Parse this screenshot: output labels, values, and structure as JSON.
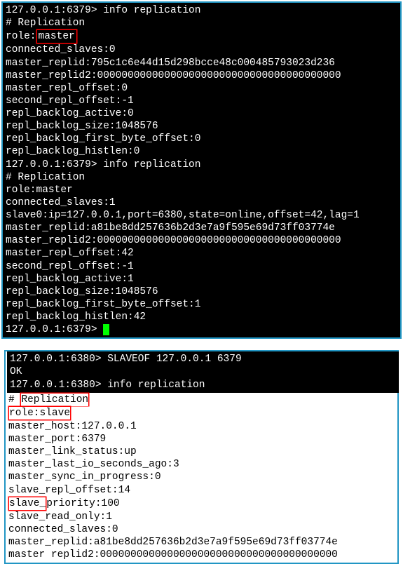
{
  "terminal1": {
    "prompt_a": "127.0.0.1:6379> ",
    "cmd_a": "info replication",
    "lines_a": [
      "# Replication",
      "role:",
      "connected_slaves:0",
      "master_replid:795c1c6e44d15d298bcce48c000485793023d236",
      "master_replid2:0000000000000000000000000000000000000000",
      "master_repl_offset:0",
      "second_repl_offset:-1",
      "repl_backlog_active:0",
      "repl_backlog_size:1048576",
      "repl_backlog_first_byte_offset:0",
      "repl_backlog_histlen:0"
    ],
    "role_hi_a": "master",
    "prompt_b": "127.0.0.1:6379> ",
    "cmd_b": "info replication",
    "lines_b": [
      "# Replication",
      "role:master",
      "connected_slaves:1",
      "slave0:ip=127.0.0.1,port=6380,state=online,offset=42,lag=1",
      "master_replid:a81be8dd257636b2d3e7a9f595e69d73ff03774e",
      "master_replid2:0000000000000000000000000000000000000000",
      "master_repl_offset:42",
      "second_repl_offset:-1",
      "repl_backlog_active:1",
      "repl_backlog_size:1048576",
      "repl_backlog_first_byte_offset:1",
      "repl_backlog_histlen:42"
    ],
    "prompt_c": "127.0.0.1:6379> "
  },
  "terminal2": {
    "header": {
      "prompt1": "127.0.0.1:6380> ",
      "cmd1": "SLAVEOF 127.0.0.1 6379",
      "ok": "OK",
      "prompt2": "127.0.0.1:6380> ",
      "cmd2": "info replication"
    },
    "lines": [
      "# Replication",
      "role:slave",
      "master_host:127.0.0.1",
      "master_port:6379",
      "master_link_status:up",
      "master_last_io_seconds_ago:3",
      "master_sync_in_progress:0",
      "slave_repl_offset:14",
      "slave_priority:100",
      "slave_read_only:1",
      "connected_slaves:0",
      "master_replid:a81be8dd257636b2d3e7a9f595e69d73ff03774e",
      "master replid2:000000000000000000000000000000000000000"
    ],
    "hi_replication": "Replication",
    "hi_role": "role:slave",
    "hi_slave": "slave_"
  },
  "watermark": ""
}
